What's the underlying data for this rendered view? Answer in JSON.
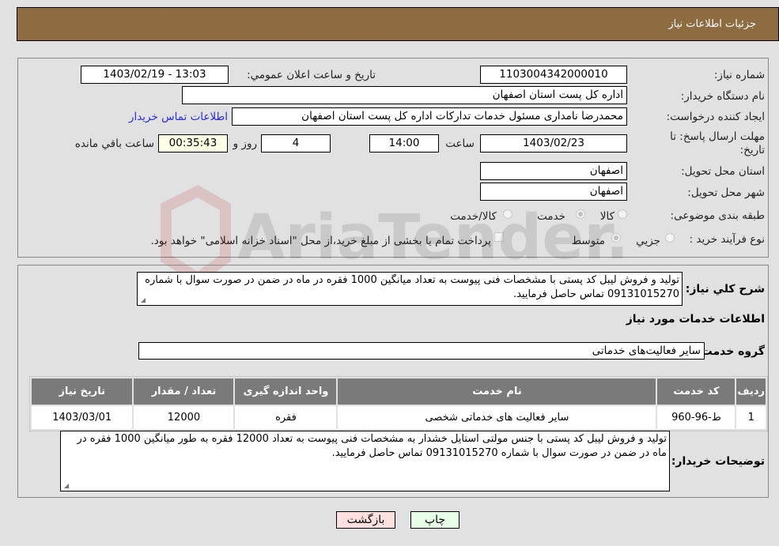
{
  "header": {
    "title": "جزئیات اطلاعات نیاز"
  },
  "form": {
    "need_number": {
      "label": "شماره نیاز:",
      "value": "1103004342000010"
    },
    "announce_datetime": {
      "label": "تاریخ و ساعت اعلان عمومي:",
      "value": "1403/02/19 - 13:03"
    },
    "buyer_org": {
      "label": "نام دستگاه خريدار:",
      "value": "اداره کل پست استان اصفهان"
    },
    "requester": {
      "label": "ایجاد کننده درخواست:",
      "value": "محمدرضا نامداری مسئول خدمات تدارکات اداره کل پست استان اصفهان",
      "contact_link": "اطلاعات تماس خریدار"
    },
    "deadline": {
      "label_line1": "مهلت ارسال پاسخ: تا",
      "label_line2": "تاریخ:",
      "date": "1403/02/23",
      "time_label": "ساعت",
      "time": "14:00",
      "days": "4",
      "days_label": "روز و",
      "remaining": "00:35:43",
      "remaining_label": "ساعت باقي مانده"
    },
    "delivery_province": {
      "label": "استان محل تحویل:",
      "value": "اصفهان"
    },
    "delivery_city": {
      "label": "شهر محل تحویل:",
      "value": "اصفهان"
    },
    "category": {
      "label": "طبقه بندی موضوعی:",
      "options": [
        "کالا",
        "خدمت",
        "کالا/خدمت"
      ],
      "selected": "خدمت"
    },
    "process_type": {
      "label": "نوع فرآیند خرید :",
      "options": [
        "جزيي",
        "متوسط"
      ],
      "selected": "متوسط",
      "treasury_note": "پرداخت تمام یا بخشی از مبلغ خرید،از محل \"اسناد خزانه اسلامی\" خواهد بود.",
      "treasury_checked": false
    }
  },
  "summary": {
    "label": "شرح کلي نياز:",
    "text": "تولید و فروش لیبل کد پستی با  مشخصات فنی پیوست به تعداد  میانگین 1000 فقره در ماه در ضمن در صورت سوال با شماره 09131015270 تماس حاصل فرمایید."
  },
  "services": {
    "section_title": "اطلاعات خدمات مورد نياز",
    "group_label": "گروه خدمت:",
    "group_value": "سایر فعالیت‌های خدماتی",
    "table": {
      "columns": [
        "رديف",
        "کد خدمت",
        "نام خدمت",
        "واحد اندازه گيری",
        "تعداد / مقدار",
        "تاريخ نياز"
      ],
      "rows": [
        [
          "1",
          "ط-96-960",
          "سایر فعالیت های خدماتی شخصی",
          "فقره",
          "12000",
          "1403/03/01"
        ]
      ]
    }
  },
  "buyer_notes": {
    "label": "توضيحات خريدار:",
    "text": "تولید و فروش لیبل کد پستی با جنس مولتی استایل خشدار به مشخصات فنی پیوست به تعداد 12000 فقره به طور میانگین 1000 فقره در ماه در ضمن در صورت سوال با شماره 09131015270 تماس حاصل فرمایید."
  },
  "buttons": {
    "print": "چاپ",
    "back": "بازگشت"
  },
  "watermark": {
    "text": "AriaTender.neT"
  }
}
